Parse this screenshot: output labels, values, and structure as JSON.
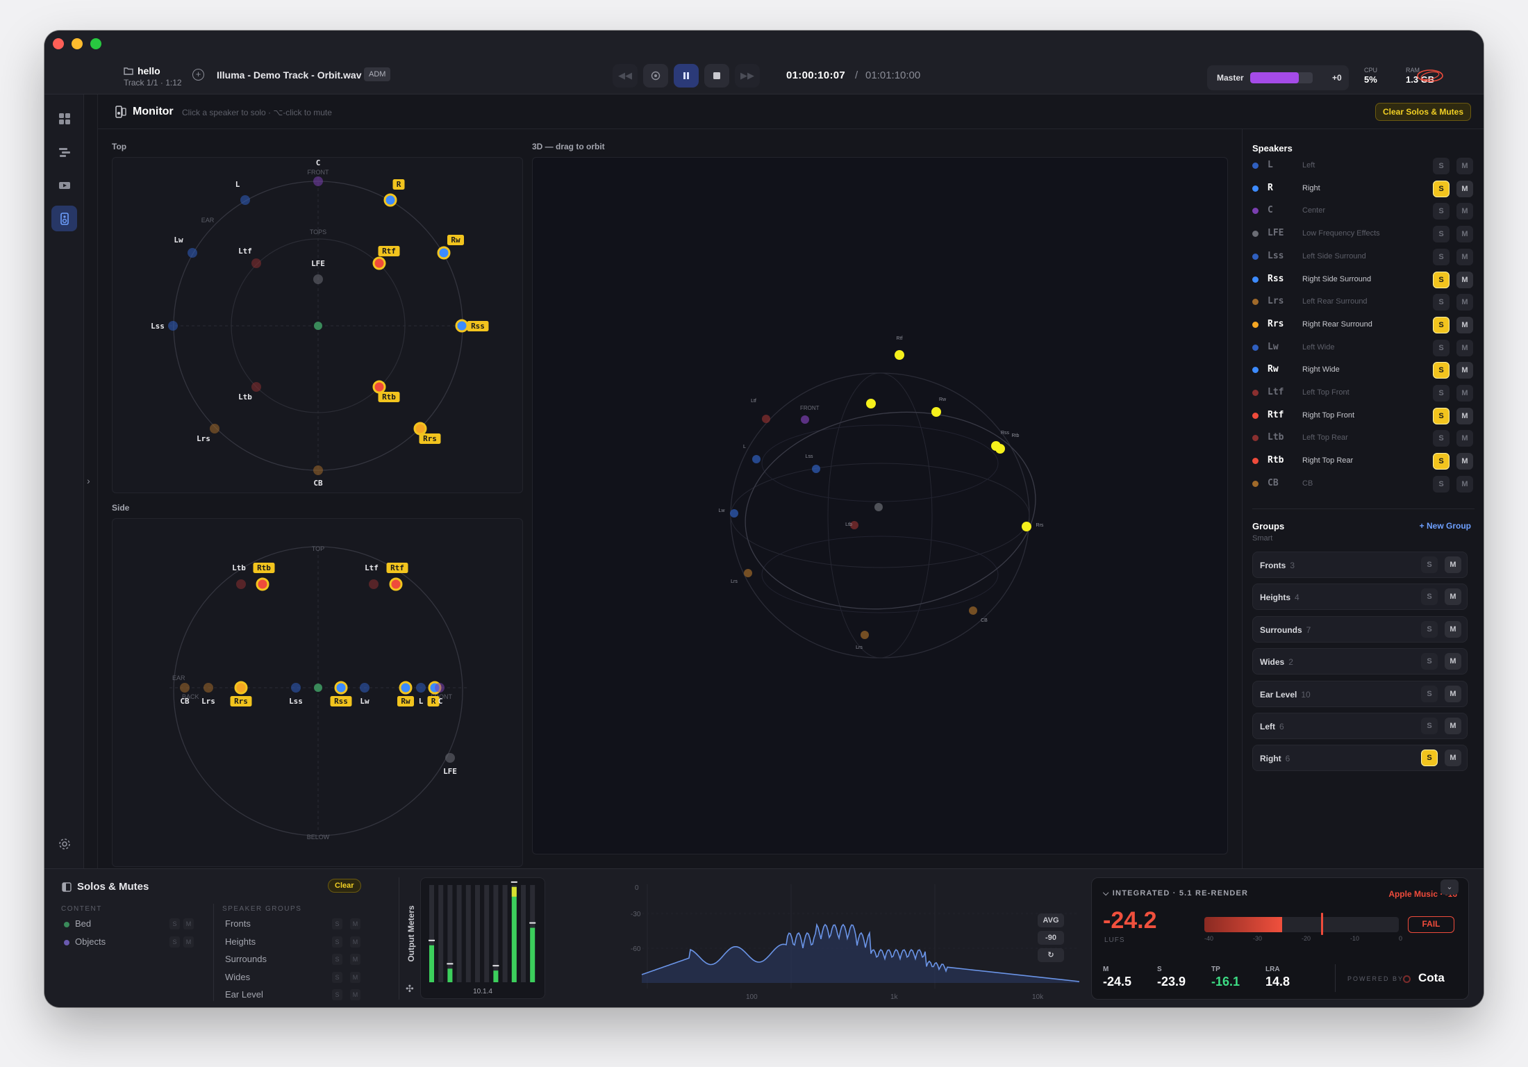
{
  "project": {
    "name": "hello",
    "track_info": "Track 1/1 · 1:12",
    "track_name": "Illuma - Demo Track - Orbit.wav",
    "format_badge": "ADM"
  },
  "transport": {
    "current_time": "01:00:10:07",
    "separator": "/",
    "total_time": "01:01:10:00"
  },
  "master": {
    "label": "Master",
    "level_fraction": 0.78,
    "gain": "+0",
    "color": "#a54be8"
  },
  "system": {
    "cpu_label": "CPU",
    "cpu_value": "5%",
    "ram_label": "RAM",
    "ram_value": "1.3 GB"
  },
  "sidebar": {
    "items": [
      "grid-icon",
      "timeline-icon",
      "media-icon",
      "monitor-icon"
    ],
    "active": "monitor-icon",
    "settings": "gear-icon"
  },
  "monitor": {
    "title": "Monitor",
    "hint": "Click a speaker to solo · ⌥-click to mute",
    "clear_button": "Clear Solos & Mutes"
  },
  "views": {
    "top_label": "Top",
    "side_label": "Side",
    "orbit_label": "3D — drag to orbit",
    "top_ring_labels": {
      "front": "FRONT",
      "ear": "EAR",
      "tops": "TOPS"
    },
    "side_ring_labels": {
      "top": "TOP",
      "ear": "EAR",
      "back": "BACK",
      "front": "FRONT",
      "below": "BELOW"
    },
    "orbit_front": "FRONT"
  },
  "speakers_title": "Speakers",
  "speakers": [
    {
      "code": "L",
      "name": "Left",
      "color": "#2f5fbf",
      "solo": false,
      "active": false
    },
    {
      "code": "R",
      "name": "Right",
      "color": "#3d8bff",
      "solo": true,
      "active": true
    },
    {
      "code": "C",
      "name": "Center",
      "color": "#7a3fb0",
      "solo": false,
      "active": false
    },
    {
      "code": "LFE",
      "name": "Low Frequency Effects",
      "color": "#6b6d75",
      "solo": false,
      "active": false
    },
    {
      "code": "Lss",
      "name": "Left Side Surround",
      "color": "#2f5fbf",
      "solo": false,
      "active": false
    },
    {
      "code": "Rss",
      "name": "Right Side Surround",
      "color": "#3d8bff",
      "solo": true,
      "active": true
    },
    {
      "code": "Lrs",
      "name": "Left Rear Surround",
      "color": "#a06a2a",
      "solo": false,
      "active": false
    },
    {
      "code": "Rrs",
      "name": "Right Rear Surround",
      "color": "#f5a623",
      "solo": true,
      "active": true
    },
    {
      "code": "Lw",
      "name": "Left Wide",
      "color": "#2f5fbf",
      "solo": false,
      "active": false
    },
    {
      "code": "Rw",
      "name": "Right Wide",
      "color": "#3d8bff",
      "solo": true,
      "active": true
    },
    {
      "code": "Ltf",
      "name": "Left Top Front",
      "color": "#8a2f2f",
      "solo": false,
      "active": false
    },
    {
      "code": "Rtf",
      "name": "Right Top Front",
      "color": "#ef4b3b",
      "solo": true,
      "active": true
    },
    {
      "code": "Ltb",
      "name": "Left Top Rear",
      "color": "#8a2f2f",
      "solo": false,
      "active": false
    },
    {
      "code": "Rtb",
      "name": "Right Top Rear",
      "color": "#ef4b3b",
      "solo": true,
      "active": true
    },
    {
      "code": "CB",
      "name": "CB",
      "color": "#a06a2a",
      "solo": false,
      "active": false
    }
  ],
  "groups": {
    "title": "Groups",
    "subtitle": "Smart",
    "new_label": "New Group",
    "items": [
      {
        "name": "Fronts",
        "count": "3",
        "solo": false
      },
      {
        "name": "Heights",
        "count": "4",
        "solo": false
      },
      {
        "name": "Surrounds",
        "count": "7",
        "solo": false
      },
      {
        "name": "Wides",
        "count": "2",
        "solo": false
      },
      {
        "name": "Ear Level",
        "count": "10",
        "solo": false
      },
      {
        "name": "Left",
        "count": "6",
        "solo": false
      },
      {
        "name": "Right",
        "count": "6",
        "solo": true
      }
    ]
  },
  "solos_mutes": {
    "title": "Solos & Mutes",
    "clear": "Clear",
    "content_head": "CONTENT",
    "content": [
      {
        "name": "Bed",
        "color": "#3a8a5a"
      },
      {
        "name": "Objects",
        "color": "#6a5ab0"
      }
    ],
    "groups_head": "SPEAKER GROUPS",
    "groups": [
      "Fronts",
      "Heights",
      "Surrounds",
      "Wides",
      "Ear Level"
    ]
  },
  "meters": {
    "title": "Output Meters",
    "readout": "10.1.4",
    "levels": [
      0.38,
      0,
      0.14,
      0,
      0,
      0,
      0,
      0.12,
      0,
      0.98,
      0,
      0.56
    ]
  },
  "spectrum": {
    "y_ticks": [
      "0",
      "-30",
      "-60"
    ],
    "x_ticks": [
      "100",
      "1k",
      "10k"
    ],
    "avg_label": "AVG",
    "floor_label": "-90"
  },
  "loudness": {
    "header": "INTEGRATED · 5.1 RE-RENDER",
    "target": "Apple Music · -16",
    "value": "-24.2",
    "unit": "LUFS",
    "bar_fraction": 0.4,
    "scale": [
      "-40",
      "-30",
      "-20",
      "-10",
      "0"
    ],
    "status": "FAIL",
    "stats": [
      {
        "k": "M",
        "v": "-24.5",
        "color": "#ffffff"
      },
      {
        "k": "S",
        "v": "-23.9",
        "color": "#ffffff"
      },
      {
        "k": "TP",
        "v": "-16.1",
        "color": "#3ddc84"
      },
      {
        "k": "LRA",
        "v": "14.8",
        "color": "#ffffff"
      }
    ],
    "powered_by": "POWERED BY",
    "brand": "Cota"
  }
}
